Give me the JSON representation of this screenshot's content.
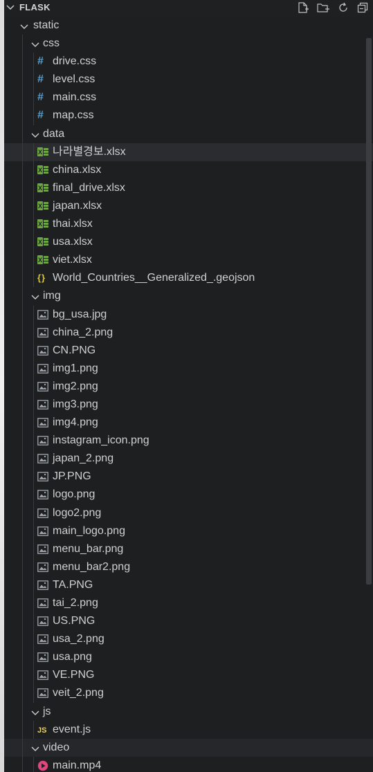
{
  "explorer": {
    "title": "FLASK",
    "actions": [
      {
        "name": "new-file-icon"
      },
      {
        "name": "new-folder-icon"
      },
      {
        "name": "refresh-icon"
      },
      {
        "name": "collapse-all-icon"
      }
    ]
  },
  "tree": [
    {
      "label": "static",
      "kind": "folder",
      "depth": 1
    },
    {
      "label": "css",
      "kind": "folder",
      "depth": 2
    },
    {
      "label": "drive.css",
      "kind": "css",
      "depth": 3
    },
    {
      "label": "level.css",
      "kind": "css",
      "depth": 3
    },
    {
      "label": "main.css",
      "kind": "css",
      "depth": 3
    },
    {
      "label": "map.css",
      "kind": "css",
      "depth": 3
    },
    {
      "label": "data",
      "kind": "folder",
      "depth": 2
    },
    {
      "label": "나라별경보.xlsx",
      "kind": "xlsx",
      "depth": 3,
      "selected": true
    },
    {
      "label": "china.xlsx",
      "kind": "xlsx",
      "depth": 3
    },
    {
      "label": "final_drive.xlsx",
      "kind": "xlsx",
      "depth": 3
    },
    {
      "label": "japan.xlsx",
      "kind": "xlsx",
      "depth": 3
    },
    {
      "label": "thai.xlsx",
      "kind": "xlsx",
      "depth": 3
    },
    {
      "label": "usa.xlsx",
      "kind": "xlsx",
      "depth": 3
    },
    {
      "label": "viet.xlsx",
      "kind": "xlsx",
      "depth": 3
    },
    {
      "label": "World_Countries__Generalized_.geojson",
      "kind": "json",
      "depth": 3
    },
    {
      "label": "img",
      "kind": "folder",
      "depth": 2
    },
    {
      "label": "bg_usa.jpg",
      "kind": "image",
      "depth": 3
    },
    {
      "label": "china_2.png",
      "kind": "image",
      "depth": 3
    },
    {
      "label": "CN.PNG",
      "kind": "image",
      "depth": 3
    },
    {
      "label": "img1.png",
      "kind": "image",
      "depth": 3
    },
    {
      "label": "img2.png",
      "kind": "image",
      "depth": 3
    },
    {
      "label": "img3.png",
      "kind": "image",
      "depth": 3
    },
    {
      "label": "img4.png",
      "kind": "image",
      "depth": 3
    },
    {
      "label": "instagram_icon.png",
      "kind": "image",
      "depth": 3
    },
    {
      "label": "japan_2.png",
      "kind": "image",
      "depth": 3
    },
    {
      "label": "JP.PNG",
      "kind": "image",
      "depth": 3
    },
    {
      "label": "logo.png",
      "kind": "image",
      "depth": 3
    },
    {
      "label": "logo2.png",
      "kind": "image",
      "depth": 3
    },
    {
      "label": "main_logo.png",
      "kind": "image",
      "depth": 3
    },
    {
      "label": "menu_bar.png",
      "kind": "image",
      "depth": 3
    },
    {
      "label": "menu_bar2.png",
      "kind": "image",
      "depth": 3
    },
    {
      "label": "TA.PNG",
      "kind": "image",
      "depth": 3
    },
    {
      "label": "tai_2.png",
      "kind": "image",
      "depth": 3
    },
    {
      "label": "US.PNG",
      "kind": "image",
      "depth": 3
    },
    {
      "label": "usa_2.png",
      "kind": "image",
      "depth": 3
    },
    {
      "label": "usa.png",
      "kind": "image",
      "depth": 3
    },
    {
      "label": "VE.PNG",
      "kind": "image",
      "depth": 3
    },
    {
      "label": "veit_2.png",
      "kind": "image",
      "depth": 3
    },
    {
      "label": "js",
      "kind": "folder",
      "depth": 2
    },
    {
      "label": "event.js",
      "kind": "js",
      "depth": 3
    },
    {
      "label": "video",
      "kind": "folder",
      "depth": 2,
      "highlight": true
    },
    {
      "label": "main.mp4",
      "kind": "video",
      "depth": 3
    }
  ],
  "colors": {
    "background": "#1e1f21",
    "text": "#cfd0d2",
    "css": "#4aa0d8",
    "xlsx": "#6aa83f",
    "json": "#d8c84a",
    "js": "#e9d26a",
    "video": "#e0457b"
  }
}
